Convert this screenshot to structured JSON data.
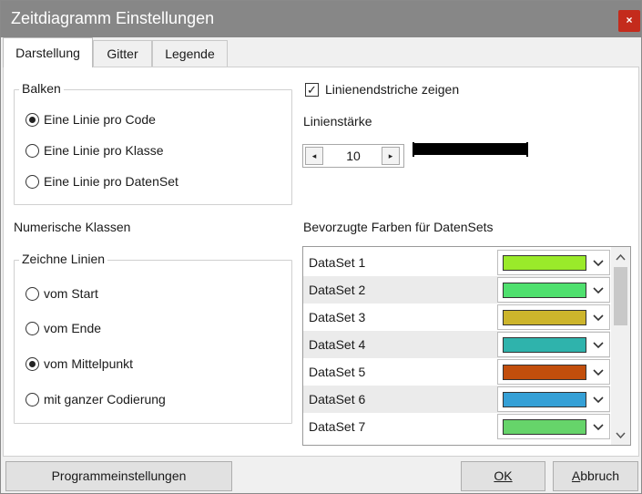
{
  "window": {
    "title": "Zeitdiagramm Einstellungen",
    "close_glyph": "×"
  },
  "tabs": [
    {
      "label": "Darstellung",
      "active": true
    },
    {
      "label": "Gitter",
      "active": false
    },
    {
      "label": "Legende",
      "active": false
    }
  ],
  "balken": {
    "legend": "Balken",
    "options": [
      {
        "label": "Eine Linie pro Code",
        "checked": true
      },
      {
        "label": "Eine Linie pro Klasse",
        "checked": false
      },
      {
        "label": "Eine Linie pro DatenSet",
        "checked": false
      }
    ]
  },
  "numerische": {
    "heading": "Numerische Klassen",
    "legend": "Zeichne Linien",
    "options": [
      {
        "label": "vom Start",
        "checked": false
      },
      {
        "label": "vom Ende",
        "checked": false
      },
      {
        "label": "vom Mittelpunkt",
        "checked": true
      },
      {
        "label": "mit ganzer Codierung",
        "checked": false
      }
    ]
  },
  "linienendstriche": {
    "label": "Linienendstriche zeigen",
    "checked": true,
    "check_glyph": "✓"
  },
  "linienstaerke": {
    "label": "Linienstärke",
    "value": "10",
    "dec_glyph": "◂",
    "inc_glyph": "▸"
  },
  "farben": {
    "heading": "Bevorzugte Farben für DatenSets",
    "datasets": [
      {
        "name": "DataSet 1",
        "color": "#9aea2a"
      },
      {
        "name": "DataSet 2",
        "color": "#4fe06e"
      },
      {
        "name": "DataSet 3",
        "color": "#cdb52c"
      },
      {
        "name": "DataSet 4",
        "color": "#2fb3ac"
      },
      {
        "name": "DataSet 5",
        "color": "#c24e0c"
      },
      {
        "name": "DataSet 6",
        "color": "#35a0d6"
      },
      {
        "name": "DataSet 7",
        "color": "#66d46a"
      }
    ]
  },
  "buttons": {
    "programmeinstellungen": "Programmeinstellungen",
    "ok": "OK",
    "abbruch": "Abbruch"
  }
}
